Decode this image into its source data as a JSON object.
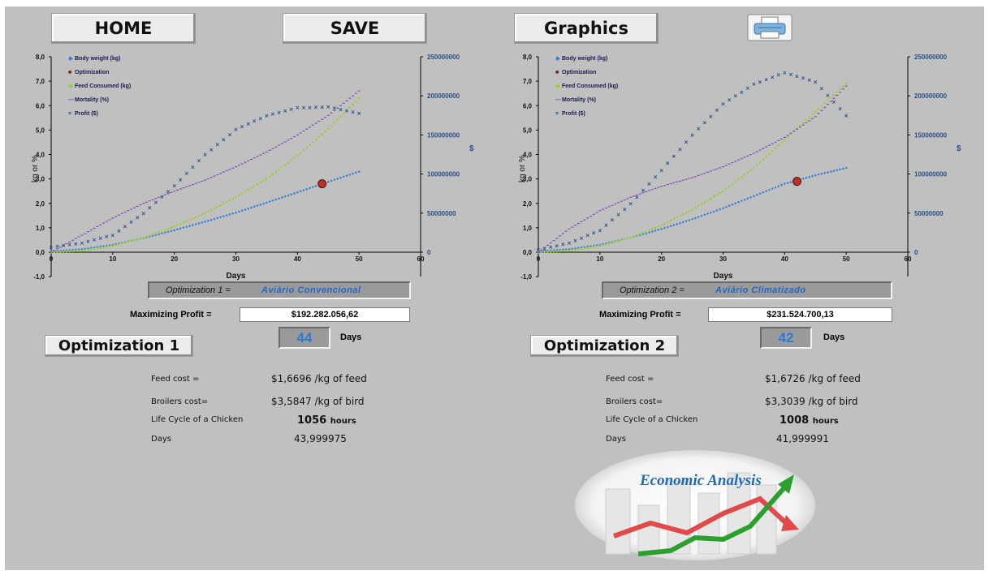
{
  "toolbar": {
    "home_label": "HOME",
    "save_label": "SAVE",
    "graphics_label": "Graphics",
    "print_icon": "printer-icon"
  },
  "charts": [
    {
      "left_axis_label": "kg  or  %",
      "right_axis_label": "$",
      "x_label": "Days",
      "left_ticks": [
        "8,0",
        "7,0",
        "6,0",
        "5,0",
        "4,0",
        "3,0",
        "2,0",
        "1,0",
        "0,0",
        "-1,0"
      ],
      "right_ticks": [
        "250000000",
        "200000000",
        "150000000",
        "100000000",
        "50000000",
        "0"
      ],
      "x_ticks": [
        "0",
        "10",
        "20",
        "30",
        "40",
        "50",
        "60"
      ],
      "legend": [
        "Body weight (kg)",
        "Optimization",
        "Feed Consumed (kg)",
        "Mortality (%)",
        "Profit ($)"
      ]
    },
    {
      "left_axis_label": "kg  or  %",
      "right_axis_label": "$",
      "x_label": "Days",
      "left_ticks": [
        "8,0",
        "7,0",
        "6,0",
        "5,0",
        "4,0",
        "3,0",
        "2,0",
        "1,0",
        "0,0",
        "-1,0"
      ],
      "right_ticks": [
        "250000000",
        "200000000",
        "150000000",
        "100000000",
        "50000000",
        "0"
      ],
      "x_ticks": [
        "0",
        "10",
        "20",
        "30",
        "40",
        "50",
        "60"
      ],
      "legend": [
        "Body weight (kg)",
        "Optimization",
        "Feed Consumed (kg)",
        "Mortality (%)",
        "Profit ($)"
      ]
    }
  ],
  "chart_data": [
    {
      "type": "scatter",
      "xlim": [
        0,
        60
      ],
      "ylim": [
        -1,
        8
      ],
      "y2lim": [
        0,
        250000000
      ],
      "series": [
        {
          "name": "Body weight (kg)",
          "axis": "left",
          "color": "#3a7fd5",
          "x": [
            0,
            5,
            10,
            15,
            20,
            25,
            30,
            35,
            40,
            45,
            50
          ],
          "y": [
            0.04,
            0.12,
            0.3,
            0.58,
            0.9,
            1.25,
            1.62,
            2.03,
            2.45,
            2.88,
            3.3
          ]
        },
        {
          "name": "Feed Consumed (kg)",
          "axis": "left",
          "color": "#9acd32",
          "x": [
            0,
            5,
            10,
            15,
            20,
            25,
            30,
            35,
            40,
            45,
            50
          ],
          "y": [
            0.0,
            0.06,
            0.25,
            0.6,
            1.05,
            1.6,
            2.25,
            3.0,
            3.95,
            5.05,
            6.3
          ]
        },
        {
          "name": "Mortality (%)",
          "axis": "left",
          "color": "#8050b0",
          "x": [
            0,
            5,
            10,
            15,
            20,
            25,
            30,
            35,
            40,
            45,
            50
          ],
          "y": [
            0.0,
            0.7,
            1.4,
            2.0,
            2.5,
            2.95,
            3.5,
            4.1,
            4.8,
            5.6,
            6.6
          ]
        },
        {
          "name": "Profit ($)",
          "axis": "right",
          "color": "#2a4f8a",
          "x": [
            0,
            5,
            10,
            15,
            20,
            25,
            30,
            35,
            40,
            45,
            50
          ],
          "y": [
            7000000,
            12000000,
            22000000,
            50000000,
            85000000,
            125000000,
            157000000,
            175000000,
            185000000,
            186000000,
            178000000
          ]
        },
        {
          "name": "Optimization",
          "axis": "left",
          "color": "#c0302a",
          "x": [
            44
          ],
          "y": [
            2.8
          ]
        }
      ]
    },
    {
      "type": "scatter",
      "xlim": [
        0,
        60
      ],
      "ylim": [
        -1,
        8
      ],
      "y2lim": [
        0,
        250000000
      ],
      "series": [
        {
          "name": "Body weight (kg)",
          "axis": "left",
          "color": "#3a7fd5",
          "x": [
            0,
            5,
            10,
            15,
            20,
            25,
            30,
            35,
            40,
            45,
            50
          ],
          "y": [
            0.04,
            0.12,
            0.3,
            0.6,
            0.95,
            1.35,
            1.8,
            2.3,
            2.8,
            3.15,
            3.45
          ]
        },
        {
          "name": "Feed Consumed (kg)",
          "axis": "left",
          "color": "#9acd32",
          "x": [
            0,
            5,
            10,
            15,
            20,
            25,
            30,
            35,
            40,
            45,
            50
          ],
          "y": [
            0.0,
            0.06,
            0.25,
            0.6,
            1.1,
            1.75,
            2.5,
            3.45,
            4.6,
            5.75,
            6.9
          ]
        },
        {
          "name": "Mortality (%)",
          "axis": "left",
          "color": "#8050b0",
          "x": [
            0,
            5,
            10,
            15,
            20,
            25,
            30,
            35,
            40,
            45,
            50
          ],
          "y": [
            0.0,
            0.95,
            1.7,
            2.25,
            2.7,
            3.05,
            3.5,
            4.05,
            4.7,
            5.55,
            6.8
          ]
        },
        {
          "name": "Profit ($)",
          "axis": "right",
          "color": "#2a4f8a",
          "x": [
            0,
            5,
            10,
            15,
            20,
            25,
            30,
            35,
            40,
            45,
            50
          ],
          "y": [
            3000000,
            12000000,
            28000000,
            62000000,
            105000000,
            150000000,
            190000000,
            215000000,
            230000000,
            218000000,
            175000000
          ]
        },
        {
          "name": "Optimization",
          "axis": "left",
          "color": "#c0302a",
          "x": [
            42
          ],
          "y": [
            2.9
          ]
        }
      ]
    }
  ],
  "panels": [
    {
      "opt_label": "Optimization 1 =",
      "opt_value": "Aviário Convencional",
      "max_profit_label": "Maximizing Profit =",
      "max_profit_value": "$192.282.056,62",
      "days_value": "44",
      "days_label": "Days",
      "opt_button": "Optimization 1",
      "feed_cost_label": "Feed cost =",
      "feed_cost_value": "$1,6696",
      "feed_cost_unit": "/kg of feed",
      "broilers_cost_label": "Broilers cost=",
      "broilers_cost_value": "$3,5847",
      "broilers_cost_unit": "/kg of bird",
      "life_cycle_label": "Life Cycle of a Chicken",
      "life_cycle_value": "1056",
      "life_cycle_unit": "hours",
      "days_row_label": "Days",
      "days_row_value": "43,999975"
    },
    {
      "opt_label": "Optimization 2 =",
      "opt_value": "Aviário Climatizado",
      "max_profit_label": "Maximizing Profit =",
      "max_profit_value": "$231.524.700,13",
      "days_value": "42",
      "days_label": "Days",
      "opt_button": "Optimization 2",
      "feed_cost_label": "Feed cost =",
      "feed_cost_value": "$1,6726",
      "feed_cost_unit": "/kg of feed",
      "broilers_cost_label": "Broilers cost=",
      "broilers_cost_value": "$3,3039",
      "broilers_cost_unit": "/kg of bird",
      "life_cycle_label": "Life Cycle of a Chicken",
      "life_cycle_value": "1008",
      "life_cycle_unit": "hours",
      "days_row_label": "Days",
      "days_row_value": "41,999991"
    }
  ],
  "logo": {
    "text": "Economic Analysis"
  }
}
